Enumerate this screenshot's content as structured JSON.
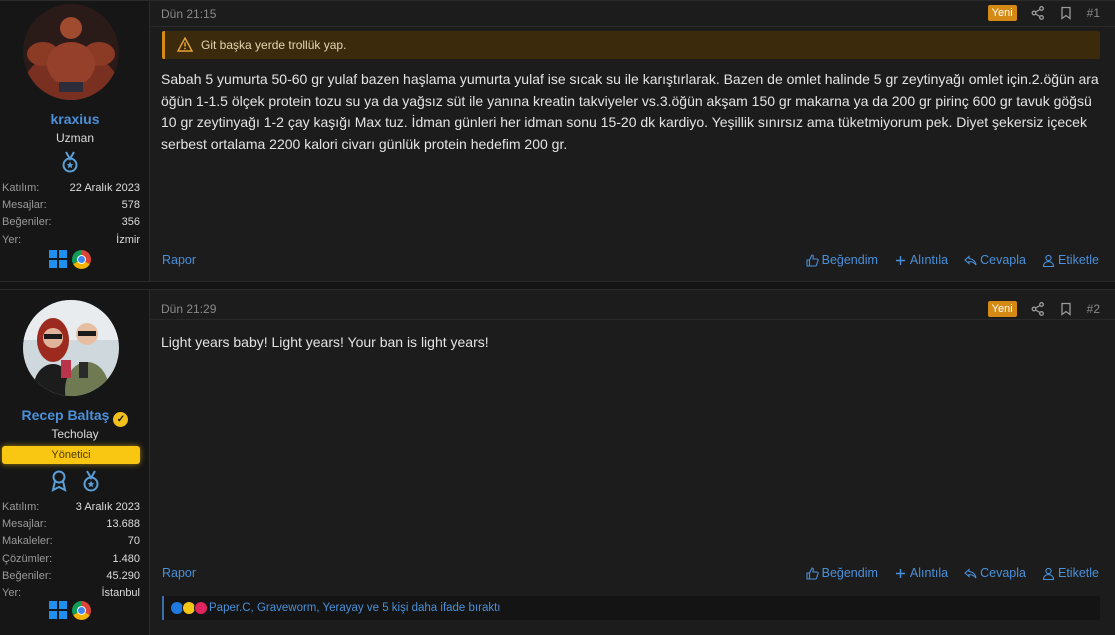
{
  "posts": [
    {
      "user": {
        "name": "kraxius",
        "title": "Uzman",
        "stats": [
          {
            "key": "Katılım:",
            "value": "22 Aralık 2023"
          },
          {
            "key": "Mesajlar:",
            "value": "578"
          },
          {
            "key": "Beğeniler:",
            "value": "356"
          },
          {
            "key": "Yer:",
            "value": "İzmir"
          }
        ]
      },
      "date": "Dün 21:15",
      "new_badge": "Yeni",
      "number": "#1",
      "warning": "Git başka yerde trollük yap.",
      "body": "Sabah 5 yumurta 50-60 gr yulaf bazen haşlama yumurta yulaf ise sıcak su ile karıştırlarak. Bazen de omlet halinde 5 gr zeytinyağı omlet için.2.öğün ara öğün 1-1.5 ölçek protein tozu su ya da yağsız süt ile yanına kreatin takviyeler vs.3.öğün akşam 150 gr makarna ya da 200 gr pirinç 600 gr tavuk göğsü 10 gr zeytinyağı 1-2 çay kaşığı Max tuz. İdman günleri her idman sonu 15-20 dk kardiyo. Yeşillik sınırsız ama tüketmiyorum pek. Diyet şekersiz içecek serbest ortalama 2200 kalori civarı günlük protein hedefim 200 gr.",
      "report": "Rapor",
      "actions": {
        "like": "Beğendim",
        "quote": "Alıntıla",
        "reply": "Cevapla",
        "tag": "Etiketle"
      }
    },
    {
      "user": {
        "name": "Recep Baltaş",
        "title": "Techolay",
        "role": "Yönetici",
        "stats": [
          {
            "key": "Katılım:",
            "value": "3 Aralık 2023"
          },
          {
            "key": "Mesajlar:",
            "value": "13.688"
          },
          {
            "key": "Makaleler:",
            "value": "70"
          },
          {
            "key": "Çözümler:",
            "value": "1.480"
          },
          {
            "key": "Beğeniler:",
            "value": "45.290"
          },
          {
            "key": "Yer:",
            "value": "İstanbul"
          }
        ]
      },
      "date": "Dün 21:29",
      "new_badge": "Yeni",
      "number": "#2",
      "body": "Light years baby! Light years! Your ban is light years!",
      "report": "Rapor",
      "actions": {
        "like": "Beğendim",
        "quote": "Alıntıla",
        "reply": "Cevapla",
        "tag": "Etiketle"
      },
      "reactions": "Paper.C, Graveworm, Yerayay ve 5 kişi daha ifade bıraktı"
    }
  ],
  "colors": {
    "link": "#4a90d9",
    "badge": "#d68a16",
    "role": "#f9c612"
  }
}
